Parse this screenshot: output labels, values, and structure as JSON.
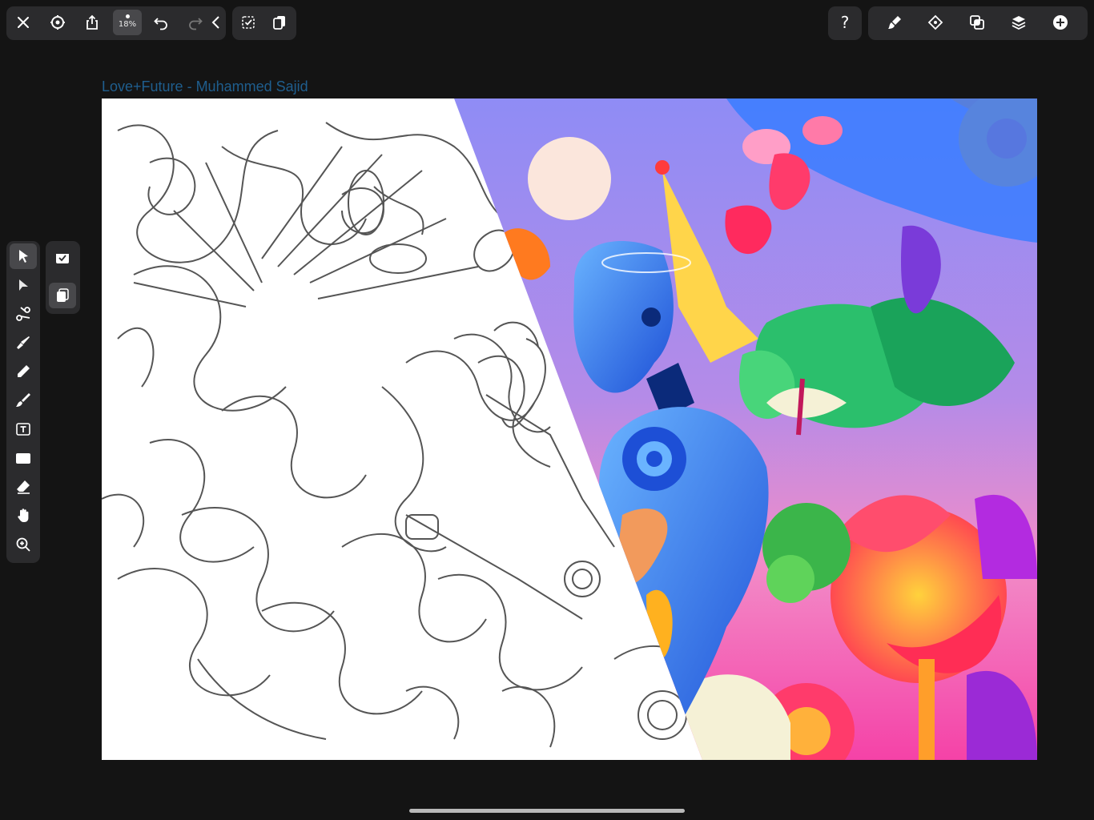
{
  "toolbar": {
    "zoom_label": "18%",
    "left_buttons": [
      "close-icon",
      "settings-icon",
      "share-icon",
      "zoom",
      "undo-icon",
      "redo-icon",
      "collapse-chevron-icon"
    ],
    "right_buttons": [
      "help-icon",
      "style-icon",
      "symbols-icon",
      "boolean-icon",
      "layers-icon",
      "add-icon"
    ],
    "help_label": "?"
  },
  "sidebar": {
    "tools": [
      "select-tool",
      "direct-select-tool",
      "scissors-tool",
      "pen-tool",
      "pencil-tool",
      "brush-tool",
      "text-tool",
      "shape-tool",
      "eraser-tool",
      "hand-tool",
      "zoom-tool"
    ],
    "active_tool": "select-tool",
    "secondary": [
      "artboard-paste-icon",
      "duplicate-icon"
    ]
  },
  "document": {
    "title": "Love+Future - Muhammed Sajid"
  },
  "colors": {
    "background": "#141414",
    "panel": "#2b2b2d",
    "title_text": "#1f5e8e",
    "sky": "#8f8cf5",
    "accent_pink": "#f542a7"
  }
}
